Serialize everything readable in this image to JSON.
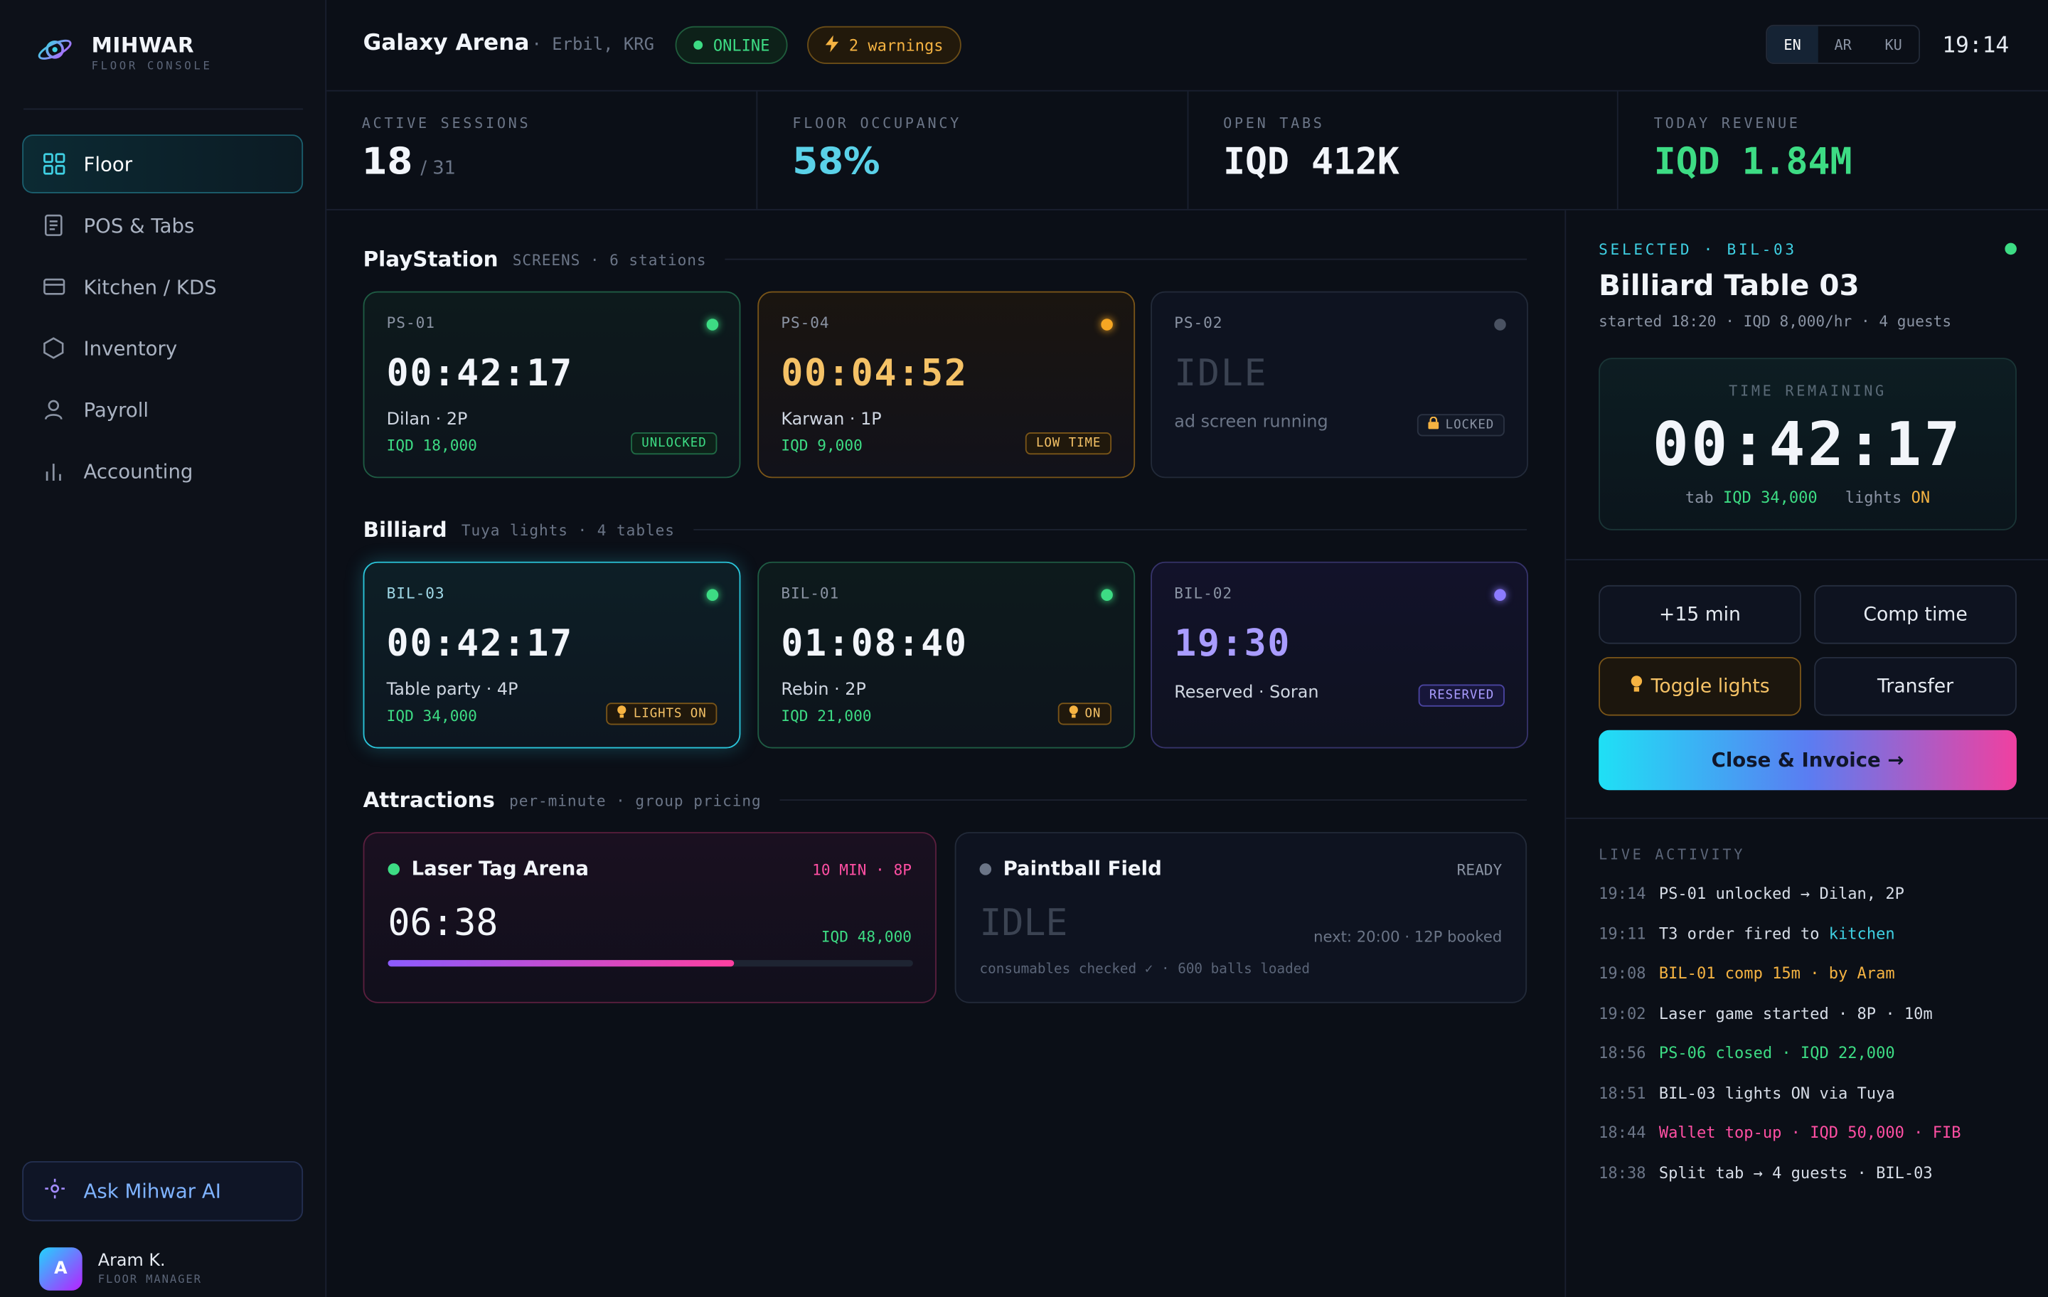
{
  "sidebar": {
    "brand": {
      "name": "MIHWAR",
      "subtitle": "FLOOR CONSOLE"
    },
    "nav": [
      {
        "label": "Floor",
        "icon": "grid-icon",
        "active": true
      },
      {
        "label": "POS & Tabs",
        "icon": "receipt-icon",
        "active": false
      },
      {
        "label": "Kitchen / KDS",
        "icon": "kitchen-display-icon",
        "active": false
      },
      {
        "label": "Inventory",
        "icon": "box-icon",
        "active": false
      },
      {
        "label": "Payroll",
        "icon": "user-icon",
        "active": false
      },
      {
        "label": "Accounting",
        "icon": "bar-chart-icon",
        "active": false
      }
    ],
    "ask": {
      "label": "Ask Mihwar AI",
      "icon": "sparkle-icon"
    },
    "user": {
      "initial": "A",
      "name": "Aram K.",
      "role": "FLOOR MANAGER"
    }
  },
  "topbar": {
    "venue": "Galaxy Arena",
    "location": "· Erbil, KRG",
    "status": "ONLINE",
    "warnings": "2 warnings",
    "languages": [
      "EN",
      "AR",
      "KU"
    ],
    "active_language": "EN",
    "clock": "19:14"
  },
  "stats": [
    {
      "label": "ACTIVE SESSIONS",
      "value": "18",
      "sub": "/ 31",
      "color": "#f2f5fa"
    },
    {
      "label": "FLOOR OCCUPANCY",
      "value": "58%",
      "sub": "",
      "color": "#5ad1e8"
    },
    {
      "label": "OPEN TABS",
      "value": "IQD 412K",
      "sub": "",
      "color": "#f2f5fa"
    },
    {
      "label": "TODAY REVENUE",
      "value": "IQD 1.84M",
      "sub": "",
      "color": "#3ddc84"
    }
  ],
  "sections": {
    "playstation": {
      "title": "PlayStation",
      "sub": "SCREENS · 6 stations"
    },
    "billiard": {
      "title": "Billiard",
      "sub": "Tuya lights · 4 tables"
    },
    "attractions": {
      "title": "Attractions",
      "sub": "per-minute · group pricing"
    }
  },
  "playstation_cards": [
    {
      "id": "PS-01",
      "time": "00:42:17",
      "who": "Dilan · 2P",
      "price": "IQD 18,000",
      "badge": "UNLOCKED",
      "state": "active"
    },
    {
      "id": "PS-04",
      "time": "00:04:52",
      "who": "Karwan · 1P",
      "price": "IQD 9,000",
      "badge": "LOW TIME",
      "state": "warning"
    },
    {
      "id": "PS-02",
      "time": "IDLE",
      "who": "ad screen running",
      "price": "",
      "badge": "LOCKED",
      "state": "idle"
    }
  ],
  "billiard_cards": [
    {
      "id": "BIL-03",
      "time": "00:42:17",
      "who": "Table party · 4P",
      "price": "IQD 34,000",
      "badge": "LIGHTS ON",
      "state": "selected"
    },
    {
      "id": "BIL-01",
      "time": "01:08:40",
      "who": "Rebin · 2P",
      "price": "IQD 21,000",
      "badge": "ON",
      "state": "active"
    },
    {
      "id": "BIL-02",
      "time": "19:30",
      "who": "Reserved · Soran",
      "price": "",
      "badge": "RESERVED",
      "state": "reserved"
    }
  ],
  "attractions": [
    {
      "name": "Laser Tag Arena",
      "meta": "10 MIN · 8P",
      "time": "06:38",
      "price": "IQD 48,000",
      "progress": 0.66
    },
    {
      "name": "Paintball Field",
      "meta": "READY",
      "time": "IDLE",
      "next": "next: 20:00 · 12P booked",
      "foot": "consumables checked ✓ · 600 balls loaded"
    }
  ],
  "panel": {
    "selected_label": "SELECTED · BIL-03",
    "title": "Billiard Table 03",
    "meta": "started 18:20 · IQD 8,000/hr · 4 guests",
    "time_label": "TIME REMAINING",
    "time": "00:42:17",
    "tab_label": "tab",
    "tab_value": "IQD 34,000",
    "lights_label": "lights",
    "lights_value": "ON",
    "buttons": {
      "add_time": "+15 min",
      "comp": "Comp time",
      "toggle_lights": "Toggle lights",
      "transfer": "Transfer",
      "close": "Close & Invoice →"
    },
    "activity_label": "LIVE ACTIVITY",
    "activity": [
      {
        "time": "19:14",
        "parts": [
          {
            "text": "PS-01 unlocked → Dilan, 2P",
            "tone": "default"
          }
        ]
      },
      {
        "time": "19:11",
        "parts": [
          {
            "text": "T3 order fired to ",
            "tone": "default"
          },
          {
            "text": "kitchen",
            "tone": "cyan"
          }
        ]
      },
      {
        "time": "19:08",
        "parts": [
          {
            "text": "BIL-01 comp 15m · by Aram",
            "tone": "amber"
          }
        ]
      },
      {
        "time": "19:02",
        "parts": [
          {
            "text": "Laser game started · 8P · 10m",
            "tone": "default"
          }
        ]
      },
      {
        "time": "18:56",
        "parts": [
          {
            "text": "PS-06 closed · IQD 22,000",
            "tone": "green"
          }
        ]
      },
      {
        "time": "18:51",
        "parts": [
          {
            "text": "BIL-03 lights ON via Tuya",
            "tone": "default"
          }
        ]
      },
      {
        "time": "18:44",
        "parts": [
          {
            "text": "Wallet top-up · IQD 50,000 · FIB",
            "tone": "pink"
          }
        ]
      },
      {
        "time": "18:38",
        "parts": [
          {
            "text": "Split tab → 4 guests · BIL-03",
            "tone": "default"
          }
        ]
      }
    ]
  },
  "colors": {
    "green": "#3ddc84",
    "amber": "#f5b342",
    "cyan": "#3fd0e3",
    "purple": "#9b8cff",
    "pink": "#ff4fa3",
    "idle": "#3b4352"
  }
}
